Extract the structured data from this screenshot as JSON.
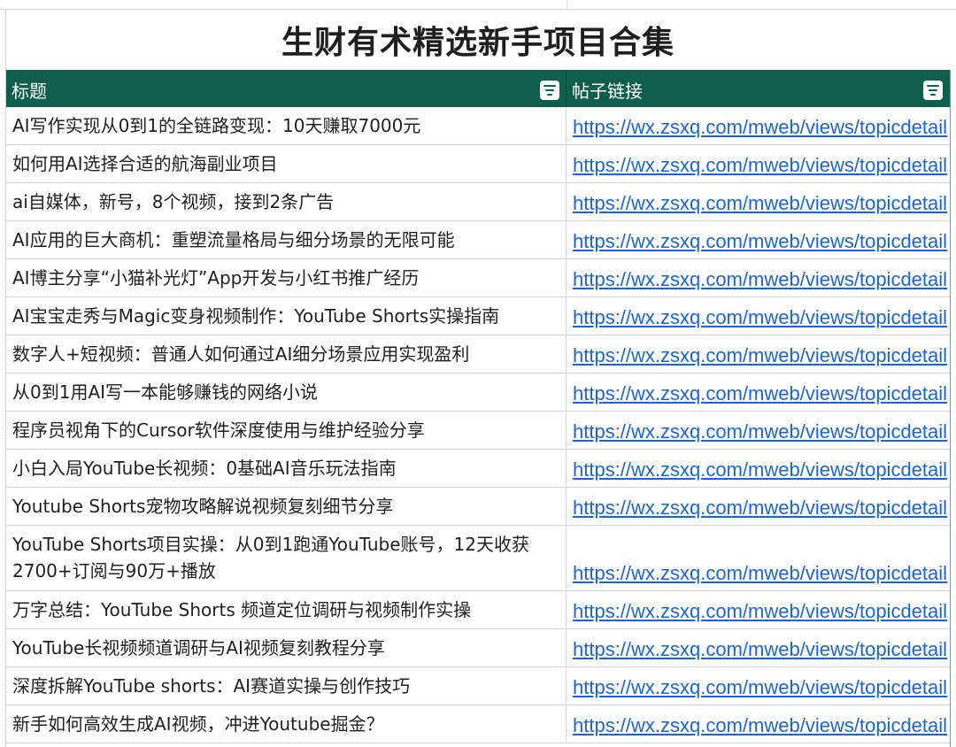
{
  "title": "生财有术精选新手项目合集",
  "columns": [
    "标题",
    "帖子链接"
  ],
  "icons": {
    "filter": "filter-icon"
  },
  "colors": {
    "header_bg": "#0e5f4a",
    "link": "#1a64d8"
  },
  "rows": [
    {
      "title": "AI写作实现从0到1的全链路变现：10天赚取7000元",
      "link": "https://wx.zsxq.com/mweb/views/topicdetail"
    },
    {
      "title": "如何用AI选择合适的航海副业项目",
      "link": "https://wx.zsxq.com/mweb/views/topicdetail"
    },
    {
      "title": "ai自媒体，新号，8个视频，接到2条广告",
      "link": "https://wx.zsxq.com/mweb/views/topicdetail"
    },
    {
      "title": "AI应用的巨大商机：重塑流量格局与细分场景的无限可能",
      "link": "https://wx.zsxq.com/mweb/views/topicdetail"
    },
    {
      "title": "AI博主分享“小猫补光灯”App开发与小红书推广经历",
      "link": "https://wx.zsxq.com/mweb/views/topicdetail"
    },
    {
      "title": "AI宝宝走秀与Magic变身视频制作：YouTube Shorts实操指南",
      "link": "https://wx.zsxq.com/mweb/views/topicdetail"
    },
    {
      "title": "数字人+短视频：普通人如何通过AI细分场景应用实现盈利",
      "link": "https://wx.zsxq.com/mweb/views/topicdetail"
    },
    {
      "title": "从0到1用AI写一本能够赚钱的网络小说",
      "link": "https://wx.zsxq.com/mweb/views/topicdetail"
    },
    {
      "title": "程序员视角下的Cursor软件深度使用与维护经验分享",
      "link": "https://wx.zsxq.com/mweb/views/topicdetail"
    },
    {
      "title": "小白入局YouTube长视频：0基础AI音乐玩法指南",
      "link": "https://wx.zsxq.com/mweb/views/topicdetail"
    },
    {
      "title": "Youtube Shorts宠物攻略解说视频复刻细节分享",
      "link": "https://wx.zsxq.com/mweb/views/topicdetail"
    },
    {
      "title": "YouTube Shorts项目实操：从0到1跑通YouTube账号，12天收获2700+订阅与90万+播放",
      "link": "https://wx.zsxq.com/mweb/views/topicdetail"
    },
    {
      "title": "万字总结：YouTube Shorts 频道定位调研与视频制作实操",
      "link": "https://wx.zsxq.com/mweb/views/topicdetail"
    },
    {
      "title": "YouTube长视频频道调研与AI视频复刻教程分享",
      "link": "https://wx.zsxq.com/mweb/views/topicdetail"
    },
    {
      "title": "深度拆解YouTube shorts：AI赛道实操与创作技巧",
      "link": "https://wx.zsxq.com/mweb/views/topicdetail"
    },
    {
      "title": "新手如何高效生成AI视频，冲进Youtube掘金？",
      "link": "https://wx.zsxq.com/mweb/views/topicdetail"
    }
  ]
}
